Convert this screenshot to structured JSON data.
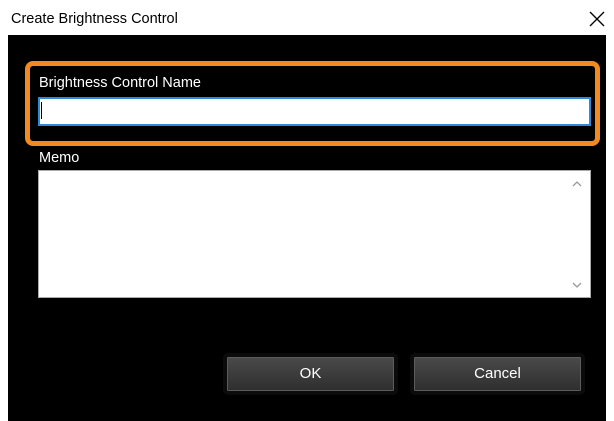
{
  "window": {
    "title": "Create Brightness Control",
    "close_icon": "close-icon"
  },
  "form": {
    "name_label": "Brightness Control Name",
    "name_value": "",
    "memo_label": "Memo",
    "memo_value": "",
    "memo_scroll_up_icon": "chevron-up-icon",
    "memo_scroll_down_icon": "chevron-down-icon"
  },
  "buttons": {
    "ok_label": "OK",
    "cancel_label": "Cancel"
  },
  "colors": {
    "highlight_outline": "#f18a21",
    "focus_border": "#2e8ad8",
    "client_background": "#000000"
  }
}
